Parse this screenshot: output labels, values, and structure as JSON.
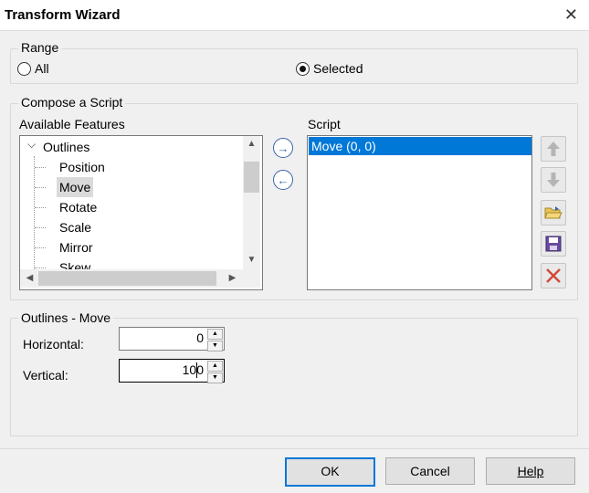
{
  "window": {
    "title": "Transform Wizard",
    "close_glyph": "✕"
  },
  "range": {
    "legend": "Range",
    "options": [
      {
        "label": "All",
        "selected": false
      },
      {
        "label": "Selected",
        "selected": true
      }
    ]
  },
  "compose": {
    "legend": "Compose a Script",
    "available_label": "Available Features",
    "tree": {
      "root": "Outlines",
      "expander_glyph": "⌵",
      "children": [
        "Position",
        "Move",
        "Rotate",
        "Scale",
        "Mirror",
        "Skew"
      ],
      "selected": "Move"
    },
    "script_label": "Script",
    "script_items": [
      "Move (0, 0)"
    ],
    "add_icon": "→",
    "remove_icon": "←",
    "side_icons": [
      "move-up-icon",
      "move-down-icon",
      "open-folder-icon",
      "save-disk-icon",
      "delete-x-icon"
    ]
  },
  "params": {
    "legend": "Outlines - Move",
    "horizontal_label": "Horizontal:",
    "horizontal_value": "0",
    "vertical_label": "Vertical:",
    "vertical_value": "100"
  },
  "buttons": {
    "ok": "OK",
    "cancel": "Cancel",
    "help": "Help"
  },
  "colors": {
    "selection": "#0078d7",
    "default_button_border": "#0078d7"
  }
}
